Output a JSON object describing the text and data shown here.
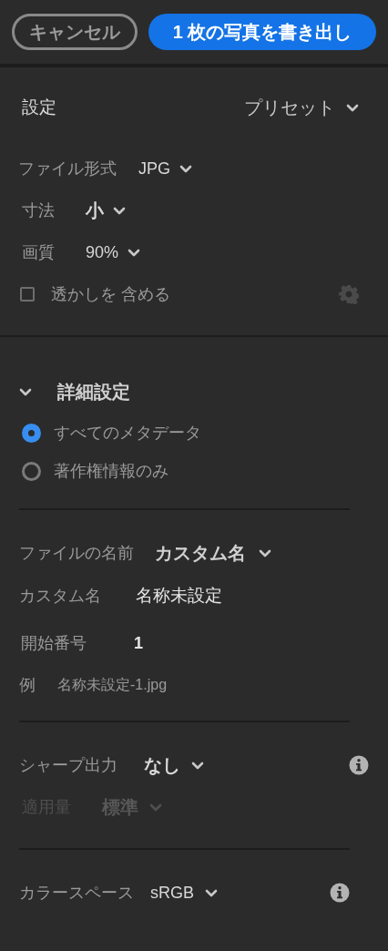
{
  "header": {
    "cancel": "キャンセル",
    "export": "1 枚の写真を書き出し"
  },
  "settings": {
    "title": "設定",
    "preset": "プリセット",
    "rows": [
      {
        "label": "ファイル形式",
        "value": "JPG"
      },
      {
        "label": "寸法",
        "value": "小"
      },
      {
        "label": "画質",
        "value": "90%"
      }
    ],
    "watermark": {
      "label": "透かしを 含める",
      "checked": false
    }
  },
  "advanced": {
    "title": "詳細設定",
    "expanded": true,
    "options": [
      {
        "label": "すべてのメタデータ",
        "selected": true
      },
      {
        "label": "著作権情報のみ",
        "selected": false
      }
    ]
  },
  "naming": {
    "file_name": {
      "label": "ファイルの名前",
      "value": "カスタム名"
    },
    "custom_name": {
      "label": "カスタム名",
      "value": "名称未設定"
    },
    "start_number": {
      "label": "開始番号",
      "value": "1"
    },
    "example": {
      "label": "例",
      "value": "名称未設定-1.jpg"
    }
  },
  "sharpen": {
    "output": {
      "label": "シャープ出力",
      "value": "なし",
      "disabled": false
    },
    "amount": {
      "label": "適用量",
      "value": "標準",
      "disabled": true
    }
  },
  "color_space": {
    "label": "カラースペース",
    "value": "sRGB"
  }
}
